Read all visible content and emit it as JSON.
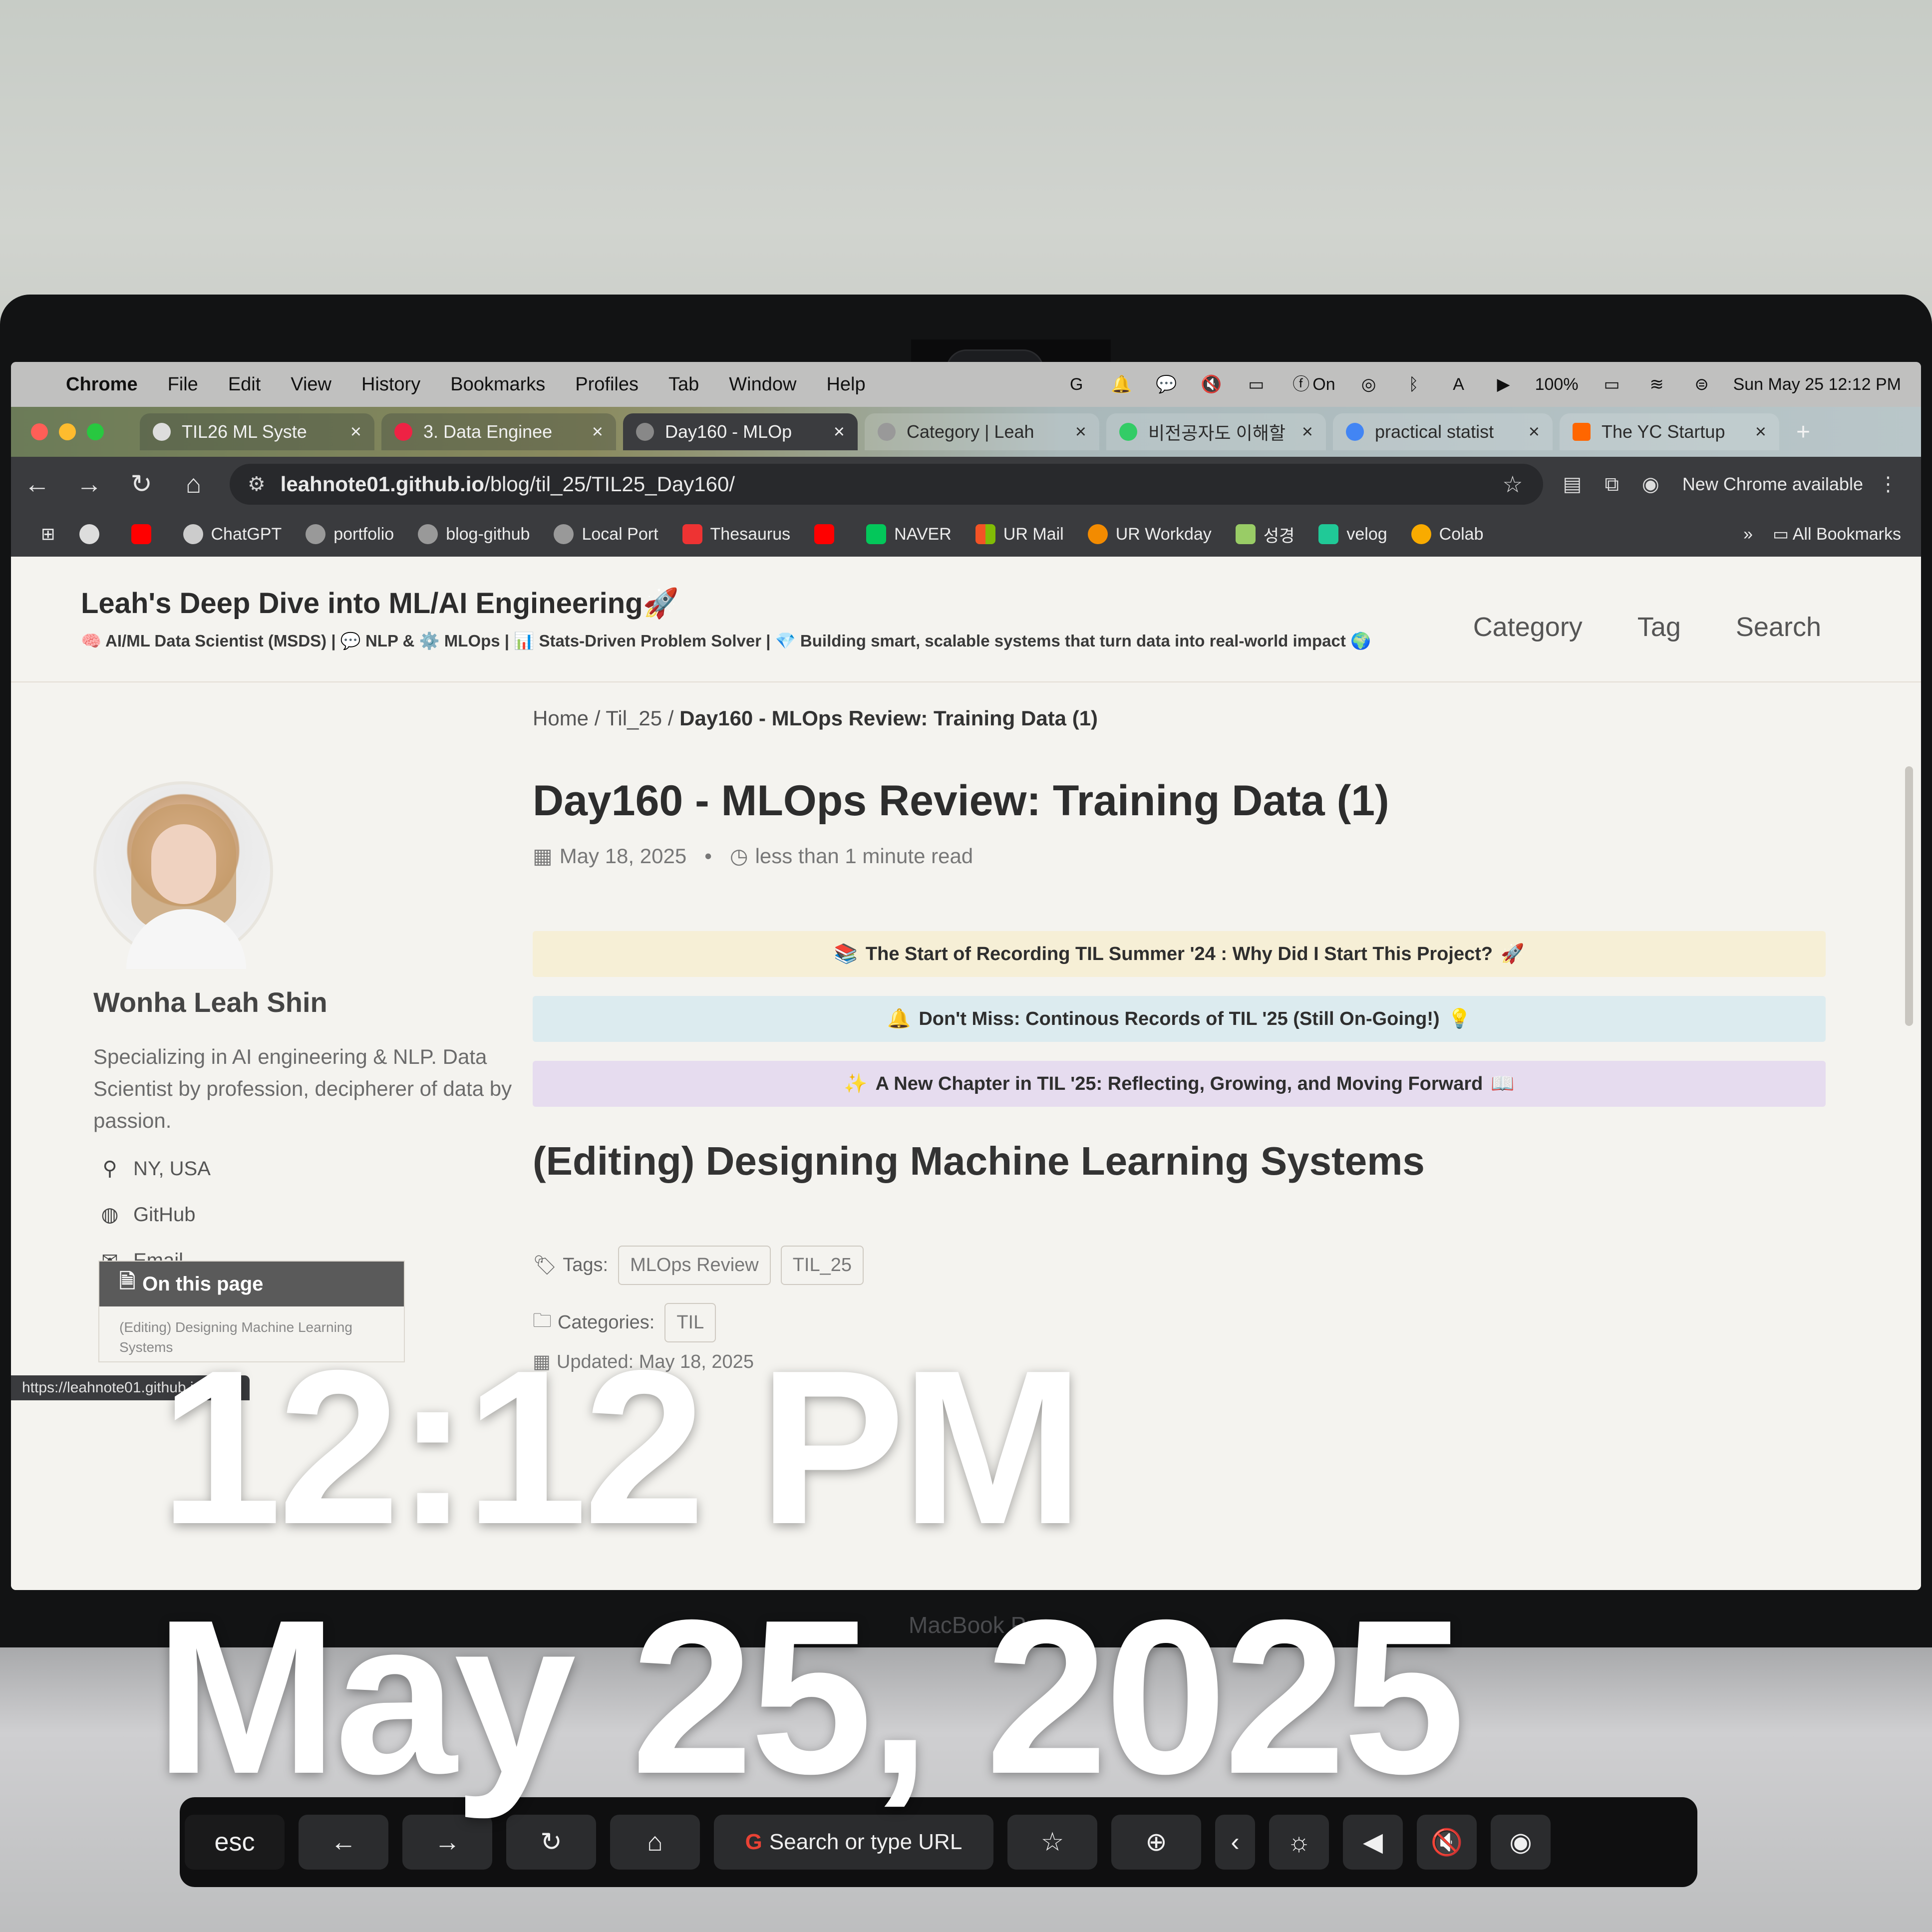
{
  "menubar": {
    "items": [
      "Chrome",
      "File",
      "Edit",
      "View",
      "History",
      "Bookmarks",
      "Profiles",
      "Tab",
      "Window",
      "Help"
    ],
    "battery": "100%",
    "datetime": "Sun May 25  12:12 PM",
    "focus_label": "On"
  },
  "tabs": [
    {
      "label": "TIL26 ML Syste",
      "close": "×"
    },
    {
      "label": "3. Data Enginee",
      "close": "×"
    },
    {
      "label": "Day160 - MLOp",
      "close": "×"
    },
    {
      "label": "Category | Leah",
      "close": "×"
    },
    {
      "label": "비전공자도 이해할",
      "close": "×"
    },
    {
      "label": "practical statist",
      "close": "×"
    },
    {
      "label": "The YC Startup",
      "close": "×"
    }
  ],
  "toolbar": {
    "url_host": "leahnote01.github.io",
    "url_path": "/blog/til_25/TIL25_Day160/",
    "update_label": "New Chrome available"
  },
  "bookmarks": {
    "items": [
      "ChatGPT",
      "portfolio",
      "blog-github",
      "Local Port",
      "Thesaurus",
      "NAVER",
      "UR Mail",
      "UR Workday",
      "성경",
      "velog",
      "Colab"
    ],
    "all_label": "All Bookmarks"
  },
  "site": {
    "title": "Leah's Deep Dive into ML/AI Engineering🚀",
    "subtitle": "🧠 AI/ML Data Scientist (MSDS) | 💬 NLP & ⚙️ MLOps | 📊 Stats-Driven Problem Solver | 💎 Building smart, scalable systems that turn data into real-world impact 🌍",
    "nav": [
      "Category",
      "Tag",
      "Search"
    ]
  },
  "breadcrumb": {
    "home": "Home",
    "sep1": " / ",
    "section": "Til_25",
    "sep2": " / ",
    "current": "Day160 - MLOps Review: Training Data (1)"
  },
  "author": {
    "name": "Wonha Leah Shin",
    "bio": "Specializing in AI engineering & NLP. Data Scientist by profession, decipherer of data by passion.",
    "location": "NY, USA",
    "github": "GitHub",
    "email": "Email"
  },
  "toc": {
    "title": "On this page",
    "item": "(Editing) Designing Machine Learning Systems"
  },
  "post": {
    "title": "Day160 - MLOps Review: Training Data (1)",
    "date": "May 18, 2025",
    "read_time": "less than 1 minute read",
    "notices": [
      {
        "emoji": "📚",
        "text": "The Start of Recording TIL Summer '24 : Why Did I Start This Project?",
        "emoji2": "🚀",
        "bg": "#f6efd6"
      },
      {
        "emoji": "🔔",
        "text": "Don't Miss: Continous Records of TIL '25 (Still On-Going!)",
        "emoji2": "💡",
        "bg": "#dcebef"
      },
      {
        "emoji": "✨",
        "text": "A New Chapter in TIL '25: Reflecting, Growing, and Moving Forward",
        "emoji2": "📖",
        "bg": "#e6dcef"
      }
    ],
    "section_heading": "(Editing) Designing Machine Learning Systems",
    "tags_label": "Tags:",
    "tags": [
      "MLOps Review",
      "TIL_25"
    ],
    "categories_label": "Categories:",
    "category": "TIL",
    "updated": "Updated: May 18, 2025"
  },
  "statusbar": "https://leahnote01.github.io/blog/",
  "overlay": {
    "time": "12:12 PM",
    "date": "May 25, 2025"
  },
  "laptop": {
    "chin_label": "MacBook Pro"
  },
  "touchbar": {
    "esc": "esc",
    "search": "Search or type URL"
  }
}
